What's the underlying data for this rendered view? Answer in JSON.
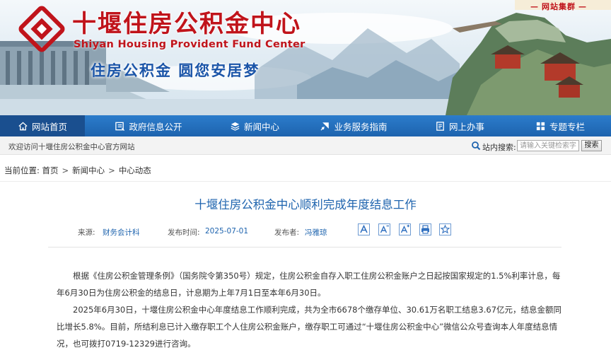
{
  "header": {
    "title": "十堰住房公积金中心",
    "subtitle": "Shiyan Housing Provident Fund Center",
    "slogan": "住房公积金  圆您安居梦",
    "site_group": "网站集群",
    "logo_icon": "housing-fund-logo-icon",
    "brand_color": "#c0141b"
  },
  "nav": {
    "items": [
      {
        "label": "网站首页",
        "icon": "home-icon",
        "active": true
      },
      {
        "label": "政府信息公开",
        "icon": "folder-icon",
        "active": false
      },
      {
        "label": "新闻中心",
        "icon": "layers-icon",
        "active": false
      },
      {
        "label": "业务服务指南",
        "icon": "compass-icon",
        "active": false
      },
      {
        "label": "网上办事",
        "icon": "document-icon",
        "active": false
      },
      {
        "label": "专题专栏",
        "icon": "grid-icon",
        "active": false
      }
    ],
    "color": "#1d63ae"
  },
  "welcome": {
    "text": "欢迎访问十堰住房公积金中心官方网站",
    "search_label": "站内搜索:",
    "search_placeholder": "请输入关键检索字",
    "search_button": "搜索"
  },
  "breadcrumb": {
    "label": "当前位置:",
    "items": [
      "首页",
      "新闻中心",
      "中心动态"
    ]
  },
  "article": {
    "title": "十堰住房公积金中心顺利完成年度结息工作",
    "source_label": "来源:",
    "source": "财务会计科",
    "date_label": "发布时间:",
    "date": "2025-07-01",
    "publisher_label": "发布者:",
    "publisher": "冯雅琼",
    "tools": [
      {
        "name": "font-large-button",
        "icon": "font-large-icon"
      },
      {
        "name": "font-small-button",
        "icon": "font-small-icon"
      },
      {
        "name": "font-plus-button",
        "icon": "font-plus-icon"
      },
      {
        "name": "print-button",
        "icon": "print-icon"
      },
      {
        "name": "favorite-button",
        "icon": "star-icon"
      }
    ],
    "paragraphs": [
      "根据《住房公积金管理条例》（国务院令第350号）规定，住房公积金自存入职工住房公积金账户之日起按国家规定的1.5%利率计息，每年6月30日为住房公积金的结息日，计息期为上年7月1日至本年6月30日。",
      "2025年6月30日，十堰住房公积金中心年度结息工作顺利完成，共为全市6678个缴存单位、30.61万名职工结息3.67亿元，结息金额同比增长5.8%。目前，所结利息已计入缴存职工个人住房公积金账户，缴存职工可通过“十堰住房公积金中心”微信公众号查询本人年度结息情况，也可拨打0719-12329进行咨询。"
    ]
  }
}
